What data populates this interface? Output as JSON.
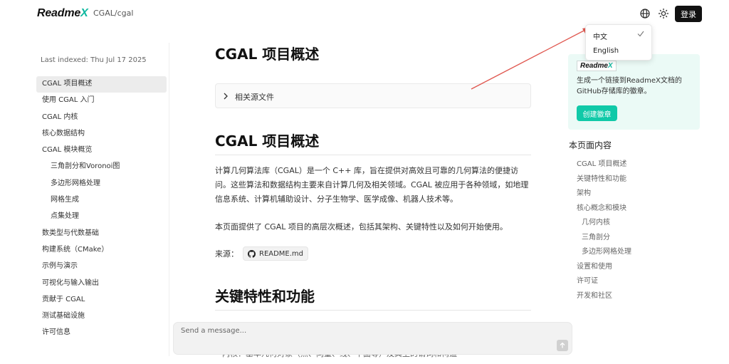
{
  "header": {
    "logo_main": "Readme",
    "logo_x": "X",
    "repo_path": "CGAL/cgal",
    "login_label": "登录"
  },
  "language_menu": {
    "items": [
      "中文",
      "English"
    ],
    "selected": "中文"
  },
  "sidebar": {
    "last_indexed": "Last indexed: Thu Jul 17 2025",
    "items": [
      {
        "label": "CGAL 项目概述",
        "level": 0,
        "active": true
      },
      {
        "label": "使用 CGAL 入门",
        "level": 0
      },
      {
        "label": "CGAL 内核",
        "level": 0
      },
      {
        "label": "核心数据结构",
        "level": 0
      },
      {
        "label": "CGAL 模块概览",
        "level": 0
      },
      {
        "label": "三角剖分和Voronoi图",
        "level": 1
      },
      {
        "label": "多边形网格处理",
        "level": 1
      },
      {
        "label": "网格生成",
        "level": 1
      },
      {
        "label": "点集处理",
        "level": 1
      },
      {
        "label": "数类型与代数基础",
        "level": 0
      },
      {
        "label": "构建系统（CMake）",
        "level": 0
      },
      {
        "label": "示例与演示",
        "level": 0
      },
      {
        "label": "可视化与输入输出",
        "level": 0
      },
      {
        "label": "贡献于 CGAL",
        "level": 0
      },
      {
        "label": "测试基础设施",
        "level": 0
      },
      {
        "label": "许可信息",
        "level": 0
      }
    ]
  },
  "main": {
    "title": "CGAL 项目概述",
    "related_label": "相关源文件",
    "section1_title": "CGAL 项目概述",
    "para1": "计算几何算法库（CGAL）是一个 C++ 库，旨在提供对高效且可靠的几何算法的便捷访问。这些算法和数据结构主要来自计算几何及相关领域。CGAL 被应用于各种领域，如地理信息系统、计算机辅助设计、分子生物学、医学成像、机器人技术等。",
    "para2": "本页面提供了 CGAL 项目的高层次概述，包括其架构、关键特性以及如何开始使用。",
    "source_label": "来源：",
    "source_file": "README.md",
    "section2_title": "关键特性和功能",
    "partial_line": "内核：基本几何对象（点、向量、线、平面等）及其上的谓词和构造"
  },
  "chat": {
    "placeholder": "Send a message..."
  },
  "promo": {
    "logo_main": "Readme",
    "logo_x": "X",
    "text": "生成一个链接到ReadmeX文档的GitHub存储库的徽章。",
    "button_label": "创建徽章"
  },
  "toc": {
    "title": "本页面内容",
    "items": [
      {
        "label": "CGAL 项目概述",
        "level": 0
      },
      {
        "label": "关键特性和功能",
        "level": 0
      },
      {
        "label": "架构",
        "level": 0
      },
      {
        "label": "核心概念和模块",
        "level": 0
      },
      {
        "label": "几何内核",
        "level": 1
      },
      {
        "label": "三角剖分",
        "level": 1
      },
      {
        "label": "多边形网格处理",
        "level": 1
      },
      {
        "label": "设置和使用",
        "level": 0
      },
      {
        "label": "许可证",
        "level": 0
      },
      {
        "label": "开发和社区",
        "level": 0
      }
    ]
  },
  "colors": {
    "accent": "#10c9a8",
    "arrow": "#e0574f",
    "promo_bg": "#ebfaf6"
  }
}
